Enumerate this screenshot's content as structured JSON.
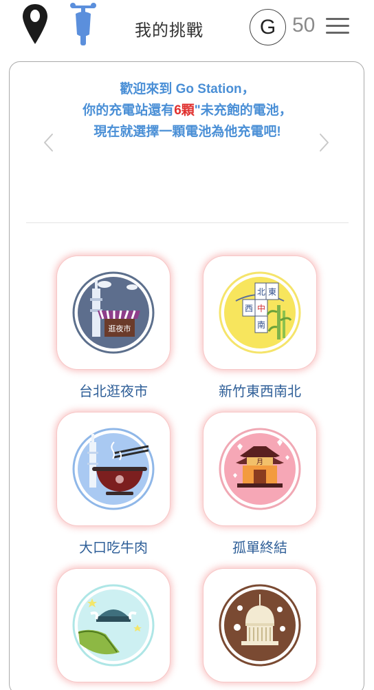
{
  "header": {
    "title": "我的挑戰",
    "coin_symbol": "G",
    "coin_count": "50"
  },
  "banner": {
    "line1": "歡迎來到 Go Station，",
    "line2_prefix": "你的充電站還有",
    "line2_count": "6顆",
    "line2_suffix": "\"未充飽的電池，",
    "line3": "現在就選擇一顆電池為他充電吧!"
  },
  "challenges": [
    {
      "label": "台北逛夜市",
      "icon": "night-market-icon",
      "sign_text": "逛夜市"
    },
    {
      "label": "新竹東西南北",
      "icon": "mahjong-icon",
      "tiles": [
        "北",
        "東",
        "西",
        "中",
        "南"
      ]
    },
    {
      "label": "大口吃牛肉",
      "icon": "beef-noodle-icon"
    },
    {
      "label": "孤單終結",
      "icon": "moon-temple-icon",
      "sign_text": "月"
    },
    {
      "label": "",
      "icon": "viking-ship-icon"
    },
    {
      "label": "",
      "icon": "memorial-hall-icon"
    }
  ],
  "colors": {
    "banner_text": "#4a8fd6",
    "banner_highlight": "#e0302e",
    "label_text": "#2f5f98",
    "scooter": "#5b8fdc"
  }
}
